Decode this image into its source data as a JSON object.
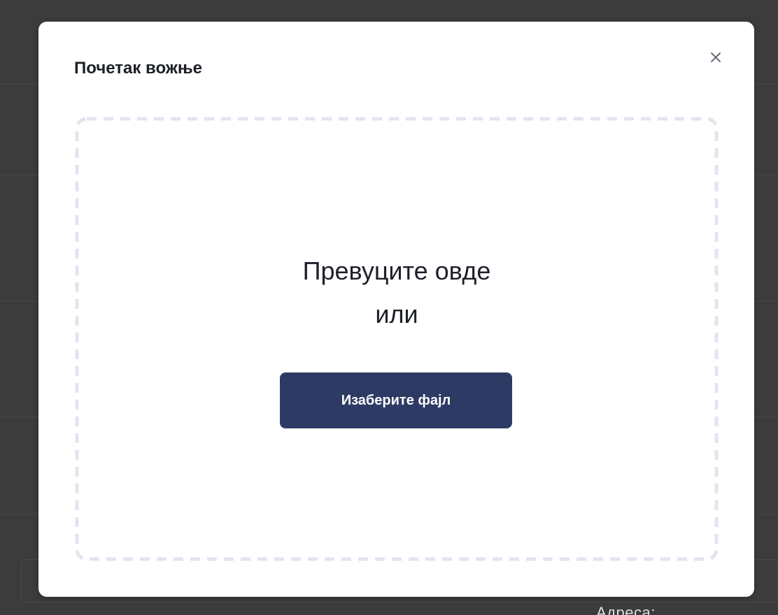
{
  "modal": {
    "title": "Почетак вожње",
    "close_icon": "close-icon"
  },
  "dropzone": {
    "line1": "Превуците овде",
    "line2": "или",
    "button_label": "Изаберите фајл"
  },
  "background": {
    "partial_label": "Адреса:"
  },
  "colors": {
    "backdrop": "#3c3c3c",
    "button": "#2d3b64",
    "dash": "#e2e5ee",
    "title": "#1d2029"
  }
}
